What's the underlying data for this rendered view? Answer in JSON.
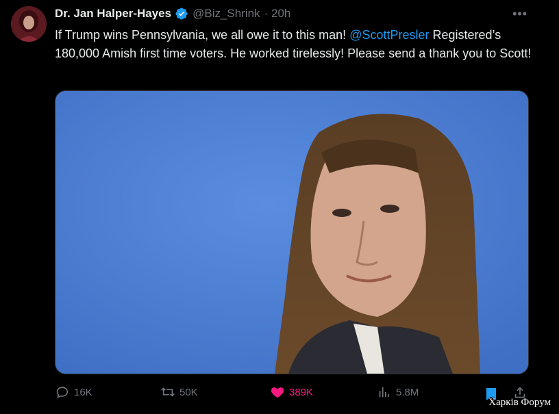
{
  "tweet": {
    "author_name": "Dr. Jan Halper-Hayes",
    "handle": "@Biz_Shrink",
    "time": "· 20h",
    "more_label": "•••",
    "text_part1": "If Trump wins Pennsylvania, we all owe it to this man! ",
    "mention": "@ScottPresler",
    "text_part2": " Registered’s 180,000 Amish first time voters. He worked tirelessly! Please send a thank you to Scott!"
  },
  "actions": {
    "replies": "16K",
    "reposts": "50K",
    "likes": "389K",
    "views": "5.8M"
  },
  "watermark": "Харків Форум",
  "colors": {
    "background": "#000000",
    "text": "#e7e9ea",
    "muted": "#71767b",
    "link": "#1d9bf0",
    "like": "#f91880",
    "verified": "#1d9bf0"
  },
  "icons": [
    "verified-badge-icon",
    "more-icon",
    "reply-icon",
    "repost-icon",
    "heart-icon",
    "views-icon",
    "bookmark-icon",
    "share-icon"
  ]
}
